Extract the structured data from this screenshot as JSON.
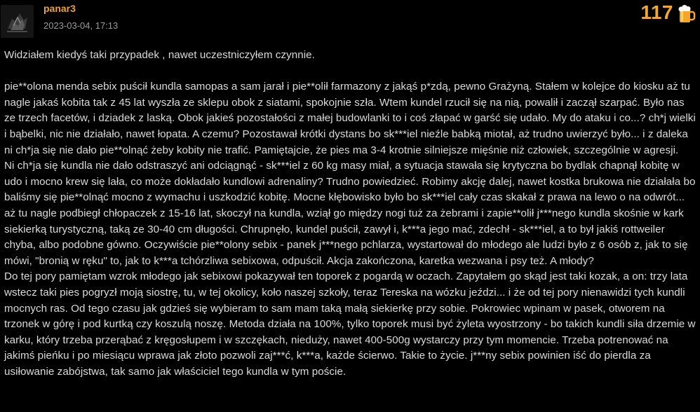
{
  "post": {
    "username": "panar3",
    "date": "2023-03-04, 17:13",
    "score": "117",
    "icons": {
      "avatar": "avatar-image",
      "beer": "beer-mug-icon"
    },
    "colors": {
      "username": "#e8a33a",
      "score": "#f0a830",
      "background": "#000000"
    },
    "paragraphs": [
      "Widziałem kiedyś taki przypadek , nawet uczestniczyłem czynnie.",
      "pie**olona menda sebix puścił kundla samopas a sam jarał i pie**olił farmazony z jakąś p*zdą, pewno Grażyną. Stałem w kolejce do kiosku aż tu nagle jakaś kobita tak z 45 lat wyszła ze sklepu obok z siatami, spokojnie szła. Wtem kundel rzucił się na nią, powalił i zaczął szarpać. Było nas ze trzech facetów, i dziadek z laską. Obok jakieś pozostałości z małej budowlanki to i coś złapać w garść się udało. My do ataku i co...? ch*j wielki i bąbelki, nic nie działało, nawet łopata. A czemu? Pozostawał krótki dystans bo sk***iel nieźle babką miotał, aż trudno uwierzyć było... i z daleka ni ch*ja się nie dało pie**olnąć żeby kobity nie trafić. Pamiętajcie, że pies ma 3-4 krotnie silniejsze mięśnie niż człowiek, szczególnie w agresji.",
      "Ni ch*ja się kundla nie dało odstraszyć ani odciągnąć - sk***iel z 60 kg masy miał, a sytuacja stawała się krytyczna bo bydlak chapnął kobitę w udo i mocno krew się lała, co może dokładało kundlowi adrenaliny? Trudno powiedzieć. Robimy akcję dalej, nawet kostka brukowa nie działała bo baliśmy się pie**olnąć mocno z wymachu i uszkodzić kobitę. Mocne kłębowisko było bo sk***iel cały czas skakał z prawa na lewo o na odwrót... aż tu nagle podbiegł chłopaczek z 15-16 lat, skoczył na kundla, wziął go między nogi tuż za żebrami i zapie**olił j***nego kundla skośnie w kark siekierką turystyczną, taką ze 30-40 cm długości. Chrupnęło, kundel puścił, zawył i, k***a jego mać, zdechł - sk***iel, a to był jakiś rottweiler chyba, albo podobne gówno. Oczywiście pie**olony sebix - panek j***nego pchlarza, wystartował do młodego ale ludzi było z 6 osób z, jak to się mówi, \"bronią w ręku\" to, jak to k***a tchórzliwa sebixowa, odpuścił. Akcja zakończona, karetka wezwana i psy też. A młody?",
      "Do tej pory pamiętam wzrok młodego jak sebixowi pokazywał ten toporek z pogardą w oczach. Zapytałem go skąd jest taki kozak, a on: trzy lata wstecz taki pies pogryzł moją siostrę, tu, w tej okolicy, koło naszej szkoły, teraz Tereska na wózku jeździ... i że od tej pory nienawidzi tych kundli mocnych ras. Od tego czasu jak gdzieś się wybieram to sam mam taką małą siekierkę przy sobie. Pokrowiec wpinam w pasek, otworem na trzonek w górę i pod kurtką czy koszulą noszę. Metoda działa na 100%, tylko toporek musi być żyleta wyostrzony - bo takich kundli siła drzemie w karku, który trzeba przerąbać z kręgosłupem i w szczękach, nieduży, nawet 400-500g wystarczy przy tym momencie. Trzeba potrenować na jakimś pieńku i po miesiącu wprawa jak złoto pozwoli zaj***ć, k***a, każde ścierwo. Takie to życie. j***ny sebix powinien iść do pierdla za usiłowanie zabójstwa, tak samo jak właściciel tego kundla w tym poście."
    ]
  }
}
